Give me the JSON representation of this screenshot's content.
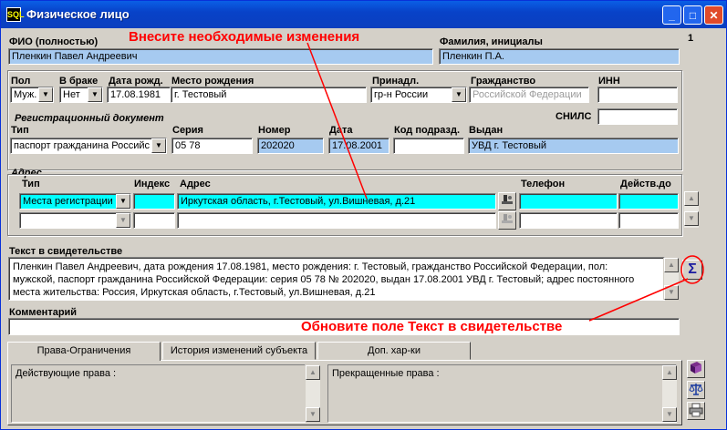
{
  "window": {
    "title": "Физическое лицо",
    "app_icon": "SQL",
    "controls": {
      "minimize": "_",
      "maximize": "□",
      "close": "✕"
    },
    "record_number": "1"
  },
  "annotations": {
    "top": "Внесите необходимые изменения",
    "bottom": "Обновите поле Текст в свидетельстве",
    "color": "#ff0000"
  },
  "person": {
    "fio_label": "ФИО (полностью)",
    "fio_value": "Пленкин Павел Андреевич",
    "short_label": "Фамилия, инициалы",
    "short_value": "Пленкин П.А.",
    "sex_label": "Пол",
    "sex_value": "Муж.",
    "married_label": "В браке",
    "married_value": "Нет",
    "birthdate_label": "Дата рожд.",
    "birthdate_value": "17.08.1981",
    "birthplace_label": "Место рождения",
    "birthplace_value": "г. Тестовый",
    "belong_label": "Принадл.",
    "belong_value": "гр-н России",
    "citizenship_label": "Гражданство",
    "citizenship_value": "Российской Федерации",
    "inn_label": "ИНН",
    "inn_value": "",
    "snils_label": "СНИЛС",
    "snils_value": ""
  },
  "document": {
    "section_label": "Регистрационный документ",
    "type_label": "Тип",
    "type_value": "паспорт гражданина Российс",
    "series_label": "Серия",
    "series_value": "05 78",
    "number_label": "Номер",
    "number_value": "202020",
    "date_label": "Дата",
    "date_value": "17.08.2001",
    "division_label": "Код подразд.",
    "division_value": "",
    "issued_label": "Выдан",
    "issued_value": "УВД г. Тестовый"
  },
  "address": {
    "section_label": "Адрес",
    "type_label": "Тип",
    "index_label": "Индекс",
    "address_label": "Адрес",
    "phone_label": "Телефон",
    "valid_label": "Действ.до",
    "rows": [
      {
        "type": "Места регистрации",
        "index": "",
        "address": "Иркутская область, г.Тестовый, ул.Вишневая, д.21",
        "phone": "",
        "valid": ""
      },
      {
        "type": "",
        "index": "",
        "address": "",
        "phone": "",
        "valid": ""
      }
    ]
  },
  "certificate": {
    "label": "Текст в свидетельстве",
    "text": "Пленкин Павел Андреевич, дата рождения 17.08.1981, место рождения: г. Тестовый, гражданство Российской Федерации, пол: мужской, паспорт гражданина Российской Федерации: серия 05 78 № 202020, выдан 17.08.2001 УВД г. Тестовый; адрес постоянного места жительства: Россия, Иркутская область, г.Тестовый, ул.Вишневая, д.21",
    "sum_button": "Σ"
  },
  "comment": {
    "label": "Комментарий",
    "value": ""
  },
  "tabs": [
    {
      "label": "Права-Ограничения"
    },
    {
      "label": "История изменений субъекта"
    },
    {
      "label": "Доп. хар-ки"
    }
  ],
  "rights": {
    "active_label": "Действующие права :",
    "ended_label": "Прекращенные права :"
  },
  "icons": [
    "book-icon",
    "scales-icon",
    "printer-icon",
    "map-pin-icon"
  ]
}
